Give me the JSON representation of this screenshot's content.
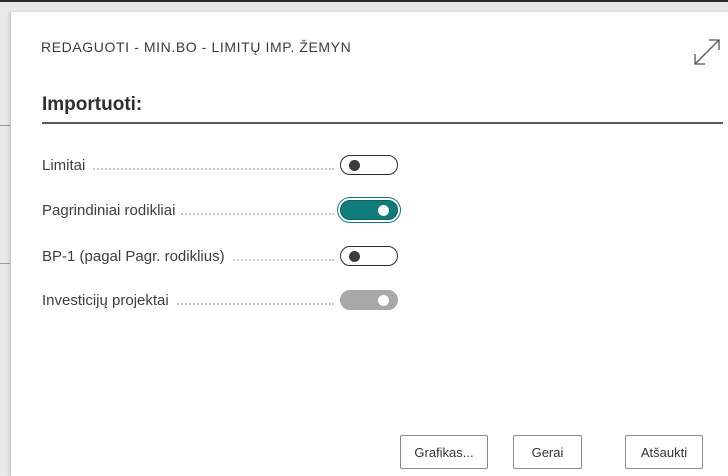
{
  "dialog": {
    "caption": "REDAGUOTI - MIN.BO - LIMITŲ IMP. ŽEMYN",
    "expand_icon": "expand-diagonal-arrows-icon"
  },
  "section": {
    "title": "Importuoti:"
  },
  "fields": [
    {
      "label": "Limitai",
      "state": "off"
    },
    {
      "label": "Pagrindiniai rodikliai",
      "state": "on"
    },
    {
      "label": "BP-1 (pagal Pagr. rodiklius)",
      "state": "off"
    },
    {
      "label": "Investicijų projektai",
      "state": "disabled"
    }
  ],
  "buttons": {
    "chart": "Grafikas...",
    "ok": "Gerai",
    "cancel": "Atšaukti"
  },
  "colors": {
    "toggle_on": "#0f7b7b",
    "toggle_disabled": "#a8a8a8",
    "text": "#3d3d3d"
  }
}
